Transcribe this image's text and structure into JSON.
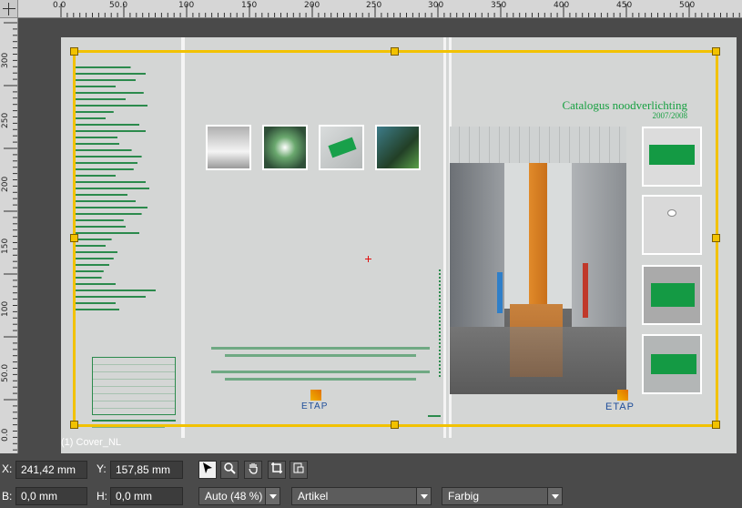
{
  "ruler": {
    "top_labels": [
      "0.0",
      "50.0",
      "100",
      "150",
      "200",
      "250",
      "300",
      "350",
      "400",
      "450",
      "500"
    ],
    "left_labels": [
      "300",
      "250",
      "200",
      "150",
      "100",
      "50.0",
      "0.0"
    ]
  },
  "document": {
    "spread_name": "(1) Cover_NL",
    "cover_title": "Catalogus noodverlichting",
    "cover_year": "2007/2008",
    "brand": "ETAP",
    "brand_back": "ETAP"
  },
  "status": {
    "x_label": "X:",
    "x_value": "241,42 mm",
    "y_label": "Y:",
    "y_value": "157,85 mm",
    "b_label": "B:",
    "b_value": "0,0 mm",
    "h_label": "H:",
    "h_value": "0,0 mm",
    "zoom": "Auto (48 %)",
    "layer": "Artikel",
    "color_mode": "Farbig"
  },
  "tools": {
    "select_icon": "pointer-icon",
    "zoom_icon": "magnifier-icon",
    "hand_icon": "hand-icon",
    "crop_icon": "crop-icon",
    "page_icon": "page-icon"
  },
  "colors": {
    "guide": "#f2c200",
    "cover_green": "#17a041",
    "etap_blue": "#1f4e9a"
  }
}
